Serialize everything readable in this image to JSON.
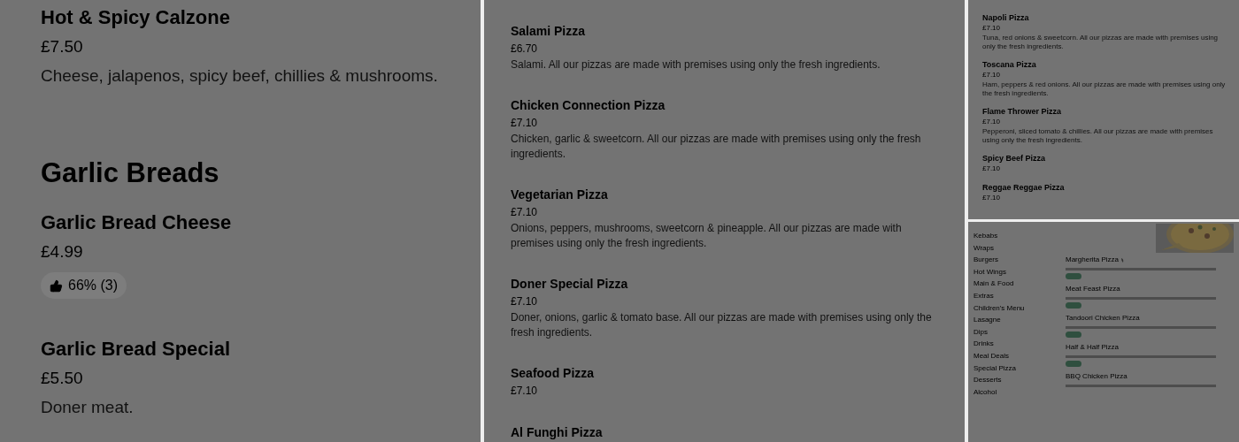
{
  "calzone_page": {
    "items": [
      {
        "name": "Hot & Spicy Calzone",
        "price": "£7.50",
        "description": "Cheese, jalapenos, spicy beef, chillies & mushrooms."
      }
    ],
    "section": {
      "title": "Garlic Breads",
      "items": [
        {
          "name": "Garlic Bread Cheese",
          "price": "£4.99",
          "rating": "66% (3)"
        },
        {
          "name": "Garlic Bread Special",
          "price": "£5.50",
          "description": "Doner meat."
        }
      ]
    }
  },
  "pizza_page": {
    "items": [
      {
        "name": "Salami Pizza",
        "price": "£6.70",
        "description": "Salami. All our pizzas are made with premises using only the fresh ingredients."
      },
      {
        "name": "Chicken Connection Pizza",
        "price": "£7.10",
        "description": "Chicken, garlic & sweetcorn. All our pizzas are made with premises using only the fresh ingredients."
      },
      {
        "name": "Vegetarian Pizza",
        "price": "£7.10",
        "description": "Onions, peppers, mushrooms, sweetcorn & pineapple. All our pizzas are made with premises using only the fresh ingredients."
      },
      {
        "name": "Doner Special Pizza",
        "price": "£7.10",
        "description": "Doner, onions, garlic & tomato base. All our pizzas are made with premises using only the fresh ingredients."
      },
      {
        "name": "Seafood Pizza",
        "price": "£7.10"
      },
      {
        "name": "Al Funghi Pizza"
      }
    ]
  },
  "pizza_list_page": {
    "items": [
      {
        "name": "Napoli Pizza",
        "price": "£7.10",
        "description": "Tuna, red onions & sweetcorn. All our pizzas are made with premises using only the fresh ingredients."
      },
      {
        "name": "Toscana Pizza",
        "price": "£7.10",
        "description": "Ham, peppers & red onions. All our pizzas are made with premises using only the fresh ingredients."
      },
      {
        "name": "Flame Thrower Pizza",
        "price": "£7.10",
        "description": "Pepperoni, sliced tomato & chillies. All our pizzas are made with premises using only the fresh ingredients."
      },
      {
        "name": "Spicy Beef Pizza",
        "price": "£7.10"
      },
      {
        "name": "Reggae Reggae Pizza",
        "price": "£7.10"
      }
    ]
  },
  "category_page": {
    "sidebar": {
      "items": [
        "Kebabs",
        "Wraps",
        "Burgers",
        "Hot Wings",
        "Main & Food",
        "Extras",
        "Children's Menu",
        "Lasagne",
        "Dips",
        "Drinks",
        "Meal Deals",
        "Special Pizza",
        "Desserts",
        "Alcohol"
      ]
    },
    "items": [
      {
        "name": "Margherita Pizza",
        "spicy": true,
        "tag": true
      },
      {
        "name": "Meat Feast Pizza",
        "spicy": false,
        "tag": true
      },
      {
        "name": "Tandoori Chicken Pizza",
        "spicy": false,
        "tag": true
      },
      {
        "name": "Half & Half Pizza",
        "spicy": false,
        "tag": true
      },
      {
        "name": "BBQ Chicken Pizza",
        "spicy": false,
        "tag": false
      }
    ]
  }
}
